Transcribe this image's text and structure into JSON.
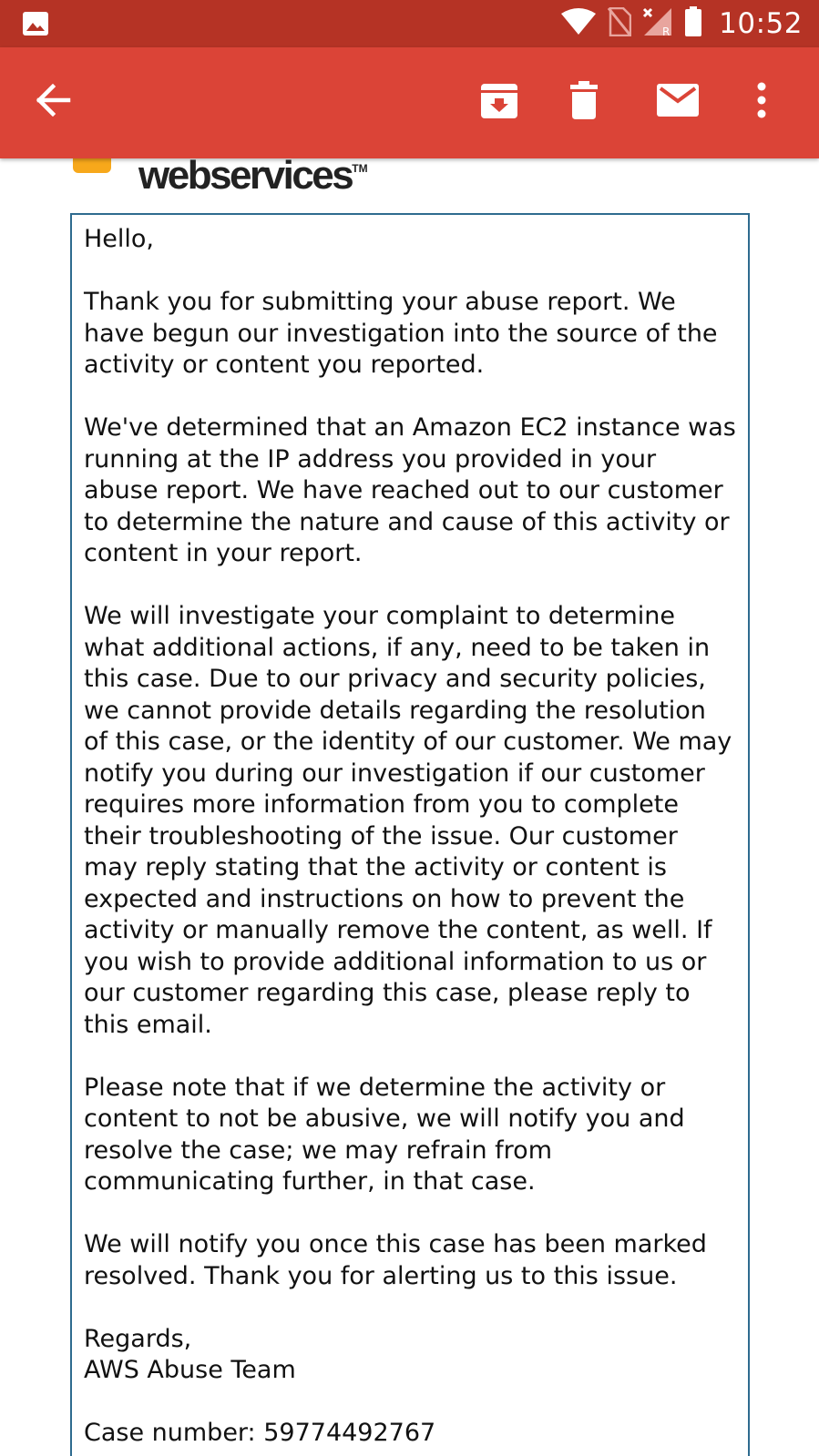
{
  "status_bar": {
    "time": "10:52",
    "left_icon": "image-icon",
    "right_icons": [
      "wifi-icon",
      "no-sim-icon",
      "signal-roaming-icon",
      "battery-icon"
    ],
    "roaming_label": "R"
  },
  "app_bar": {
    "background": "#db4437",
    "actions": [
      "back-arrow-icon",
      "archive-icon",
      "delete-icon",
      "mail-icon",
      "more-vert-icon"
    ]
  },
  "email": {
    "logo_text": "webservices",
    "logo_tm": "TM",
    "greeting": "Hello,",
    "paragraph_1": "Thank you for submitting your abuse report. We have begun our investigation into the source of the activity or content you reported.",
    "paragraph_2": "We've determined that an Amazon EC2 instance was running at the IP address you provided in your abuse report. We have reached out to our customer to determine the nature and cause of this activity or content in your report.",
    "paragraph_3": "We will investigate your complaint to determine what additional actions, if any, need to be taken in this case. Due to our privacy and security policies, we cannot provide details regarding the resolution of this case, or the identity of our customer. We may notify you during our investigation if our customer requires more information from you to complete their troubleshooting of the issue. Our customer may reply stating that the activity or content is expected and instructions on how to prevent the activity or manually remove the content, as well. If you wish to provide additional information to us or our customer regarding this case, please reply to this email.",
    "paragraph_4": "Please note that if we determine the activity or content to not be abusive, we will notify you and resolve the case; we may refrain from communicating further, in that case.",
    "paragraph_5": "We will notify you once this case has been marked resolved. Thank you for alerting us to this issue.",
    "signoff": "Regards,",
    "signature": "AWS Abuse Team",
    "case_number": "Case number: 59774492767"
  },
  "colors": {
    "status_bar": "#b53325",
    "app_bar": "#db4437",
    "box_border": "#2e6b8f",
    "logo_accent": "#f7a81b"
  }
}
